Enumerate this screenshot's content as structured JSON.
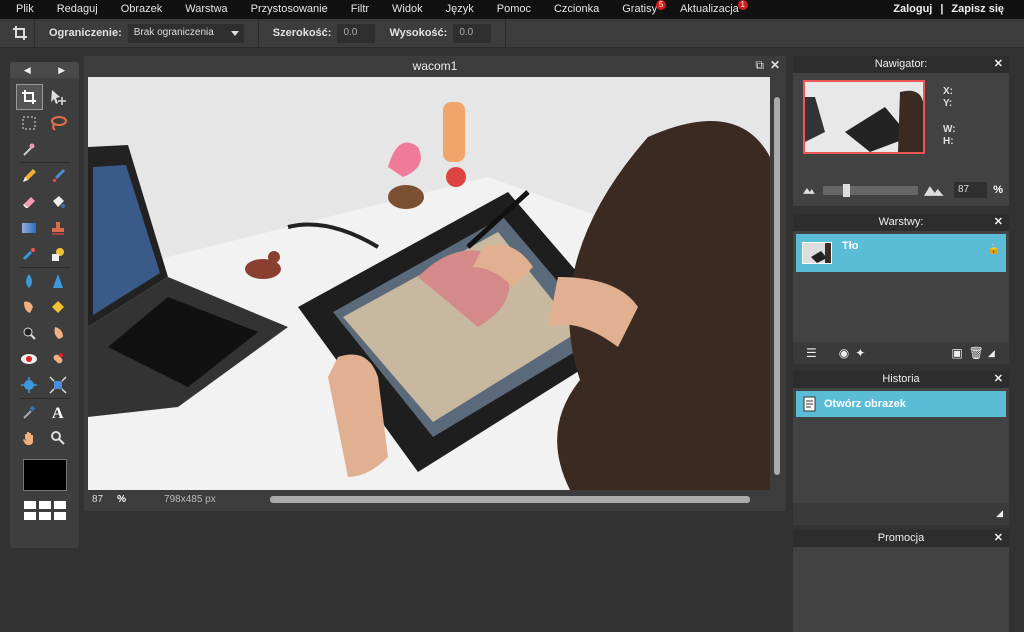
{
  "menu": {
    "items": [
      "Plik",
      "Redaguj",
      "Obrazek",
      "Warstwa",
      "Przystosowanie",
      "Filtr",
      "Widok",
      "Język",
      "Pomoc",
      "Czcionka",
      "Gratisy",
      "Aktualizacja"
    ],
    "gratisy_badge": "5",
    "aktualizacja_badge": "1",
    "login": "Zaloguj",
    "separator": "|",
    "register": "Zapisz się"
  },
  "options": {
    "constraint_label": "Ograniczenie:",
    "constraint_value": "Brak ograniczenia",
    "width_label": "Szerokość:",
    "width_value": "0.0",
    "height_label": "Wysokość:",
    "height_value": "0.0"
  },
  "tools": {
    "prev": "◀",
    "next": "▶",
    "primary_color": "#000000"
  },
  "document": {
    "title": "wacom1",
    "zoom": "87",
    "zoom_unit": "%",
    "dimensions": "798x485 px"
  },
  "navigator": {
    "title": "Nawigator:",
    "x_label": "X:",
    "y_label": "Y:",
    "w_label": "W:",
    "h_label": "H:",
    "zoom_value": "87",
    "zoom_unit": "%"
  },
  "layers": {
    "title": "Warstwy:",
    "items": [
      {
        "name": "Tło"
      }
    ]
  },
  "history": {
    "title": "Historia",
    "items": [
      {
        "name": "Otwórz obrazek"
      }
    ]
  },
  "promo": {
    "title": "Promocja"
  },
  "colors": {
    "accent": "#5bbcd6",
    "menubar": "#111111",
    "background": "#323232",
    "badge": "#d21d1d"
  }
}
